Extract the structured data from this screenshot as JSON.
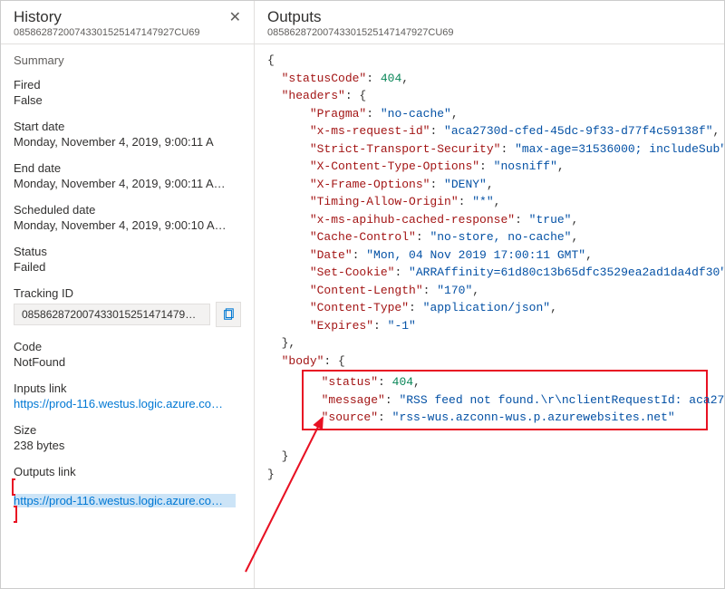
{
  "history": {
    "title": "History",
    "run_id": "08586287200743301525147147927CU69",
    "summary_heading": "Summary",
    "fired_label": "Fired",
    "fired_value": "False",
    "start_label": "Start date",
    "start_value": "Monday, November 4, 2019, 9:00:11 A",
    "end_label": "End date",
    "end_value": "Monday, November 4, 2019, 9:00:11 A…",
    "sched_label": "Scheduled date",
    "sched_value": "Monday, November 4, 2019, 9:00:10 A…",
    "status_label": "Status",
    "status_value": "Failed",
    "tracking_label": "Tracking ID",
    "tracking_value": "085862872007433015251471479…",
    "code_label": "Code",
    "code_value": "NotFound",
    "inputs_label": "Inputs link",
    "inputs_link": "https://prod-116.westus.logic.azure.co…",
    "size_label": "Size",
    "size_value": "238 bytes",
    "outputs_label": "Outputs link",
    "outputs_link": "https://prod-116.westus.logic.azure.co…"
  },
  "outputs": {
    "title": "Outputs",
    "run_id": "08586287200743301525147147927CU69",
    "json": {
      "statusCode": 404,
      "headers": {
        "Pragma": "no-cache",
        "x-ms-request-id": "aca2730d-cfed-45dc-9f33-d77f4c59138f",
        "Strict-Transport-Security": "max-age=31536000; includeSub",
        "X-Content-Type-Options": "nosniff",
        "X-Frame-Options": "DENY",
        "Timing-Allow-Origin": "*",
        "x-ms-apihub-cached-response": "true",
        "Cache-Control": "no-store, no-cache",
        "Date": "Mon, 04 Nov 2019 17:00:11 GMT",
        "Set-Cookie": "ARRAffinity=61d80c13b65dfc3529ea2ad1da4df30",
        "Content-Length": "170",
        "Content-Type": "application/json",
        "Expires": "-1"
      },
      "body": {
        "status": 404,
        "message": "RSS feed not found.\\r\\nclientRequestId: aca273",
        "source": "rss-wus.azconn-wus.p.azurewebsites.net"
      }
    }
  }
}
